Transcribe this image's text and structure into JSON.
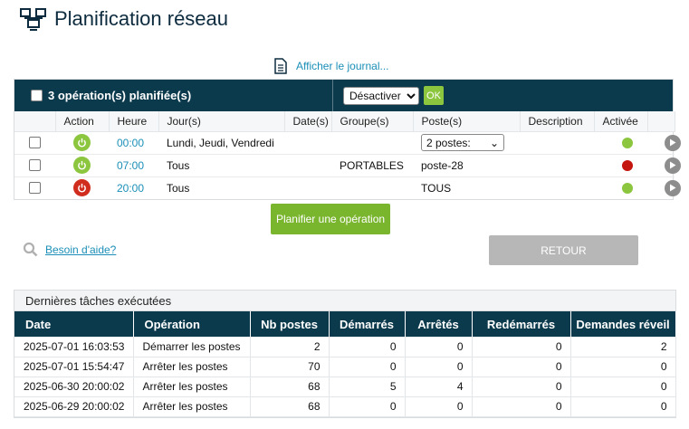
{
  "page": {
    "title": "Planification réseau"
  },
  "journal_link": "Afficher le journal...",
  "ops": {
    "count_label": "3 opération(s) planifiée(s)",
    "bulk_action_selected": "Désactiver",
    "ok_label": "OK",
    "columns": [
      "Action",
      "Heure",
      "Jour(s)",
      "Date(s)",
      "Groupe(s)",
      "Poste(s)",
      "Description",
      "Activée"
    ],
    "rows": [
      {
        "action_state": "on",
        "hour": "00:00",
        "days": "Lundi, Jeudi, Vendredi",
        "dates": "",
        "groups": "",
        "postes": "2 postes:",
        "postes_is_select": true,
        "description": "",
        "active": "green"
      },
      {
        "action_state": "on",
        "hour": "07:00",
        "days": "Tous",
        "dates": "",
        "groups": "PORTABLES",
        "postes": "poste-28",
        "postes_is_select": false,
        "description": "",
        "active": "red"
      },
      {
        "action_state": "off",
        "hour": "20:00",
        "days": "Tous",
        "dates": "",
        "groups": "",
        "postes": "TOUS",
        "postes_is_select": false,
        "description": "",
        "active": "green"
      }
    ]
  },
  "plan_button": "Planifier une opération",
  "help_link": "Besoin d'aide?",
  "back_button": "RETOUR",
  "tasks": {
    "caption": "Dernières tâches exécutées",
    "columns": [
      "Date",
      "Opération",
      "Nb postes",
      "Démarrés",
      "Arrêtés",
      "Redémarrés",
      "Demandes réveil"
    ],
    "rows": [
      [
        "2025-07-01 16:03:53",
        "Démarrer les postes",
        "2",
        "0",
        "0",
        "0",
        "2"
      ],
      [
        "2025-07-01 15:54:47",
        "Arrêter les postes",
        "70",
        "0",
        "0",
        "0",
        "0"
      ],
      [
        "2025-06-30 20:00:02",
        "Arrêter les postes",
        "68",
        "5",
        "4",
        "0",
        "0"
      ],
      [
        "2025-06-29 20:00:02",
        "Arrêter les postes",
        "68",
        "0",
        "0",
        "0",
        "0"
      ]
    ]
  },
  "colors": {
    "header_bg": "#0c3a4d",
    "accent_green": "#8cc63f",
    "link_blue": "#1b8fb7",
    "stop_red": "#d12d1f"
  },
  "icons": {
    "title": "network-icon",
    "journal": "document-icon",
    "help": "magnifier-icon"
  }
}
